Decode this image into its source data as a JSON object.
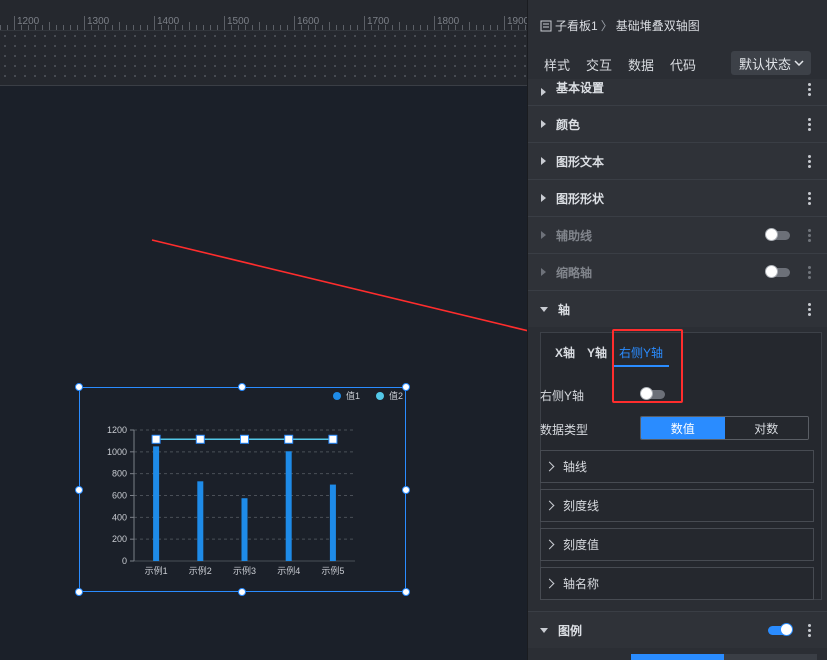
{
  "ruler": {
    "labels": [
      "1200",
      "1300",
      "1400",
      "1500",
      "1600",
      "1700",
      "1800",
      "1900"
    ]
  },
  "panel": {
    "breadcrumb": {
      "parent": "子看板1",
      "separator": "〉",
      "current": "基础堆叠双轴图"
    },
    "tabs": [
      "样式",
      "交互",
      "数据",
      "代码"
    ],
    "state_select": "默认状态",
    "sections": {
      "basic": "基本设置",
      "color": "颜色",
      "graphic_text": "图形文本",
      "graphic_shape": "图形形状",
      "guide_line": "辅助线",
      "thumbnail_axis": "缩略轴",
      "axis": "轴",
      "legend": "图例"
    },
    "axis_tabs": [
      "X轴",
      "Y轴",
      "右侧Y轴"
    ],
    "right_y_label": "右侧Y轴",
    "data_type_label": "数据类型",
    "data_type_options": [
      "数值",
      "对数"
    ],
    "sub_sections": [
      "轴线",
      "刻度线",
      "刻度值",
      "轴名称"
    ],
    "toggles": {
      "guide_line": false,
      "thumbnail_axis": false,
      "right_y": false,
      "legend": true
    }
  },
  "chart_data": {
    "type": "bar",
    "categories": [
      "示例1",
      "示例2",
      "示例3",
      "示例4",
      "示例5"
    ],
    "series": [
      {
        "name": "值1",
        "type": "bar",
        "values": [
          1050,
          730,
          575,
          1005,
          700
        ],
        "color": "#1e8be8"
      },
      {
        "name": "值2",
        "type": "line",
        "values": [
          1115,
          1115,
          1115,
          1115,
          1115
        ],
        "color": "#53c8e8"
      }
    ],
    "yticks": [
      "0",
      "200",
      "400",
      "600",
      "800",
      "1000",
      "1200"
    ],
    "ylim": [
      0,
      1200
    ],
    "legend": "top-right",
    "grid": true
  },
  "colors": {
    "accent": "#2a8cff",
    "highlight": "#ff2d2d",
    "bar": "#1e8be8",
    "line": "#53c8e8"
  }
}
